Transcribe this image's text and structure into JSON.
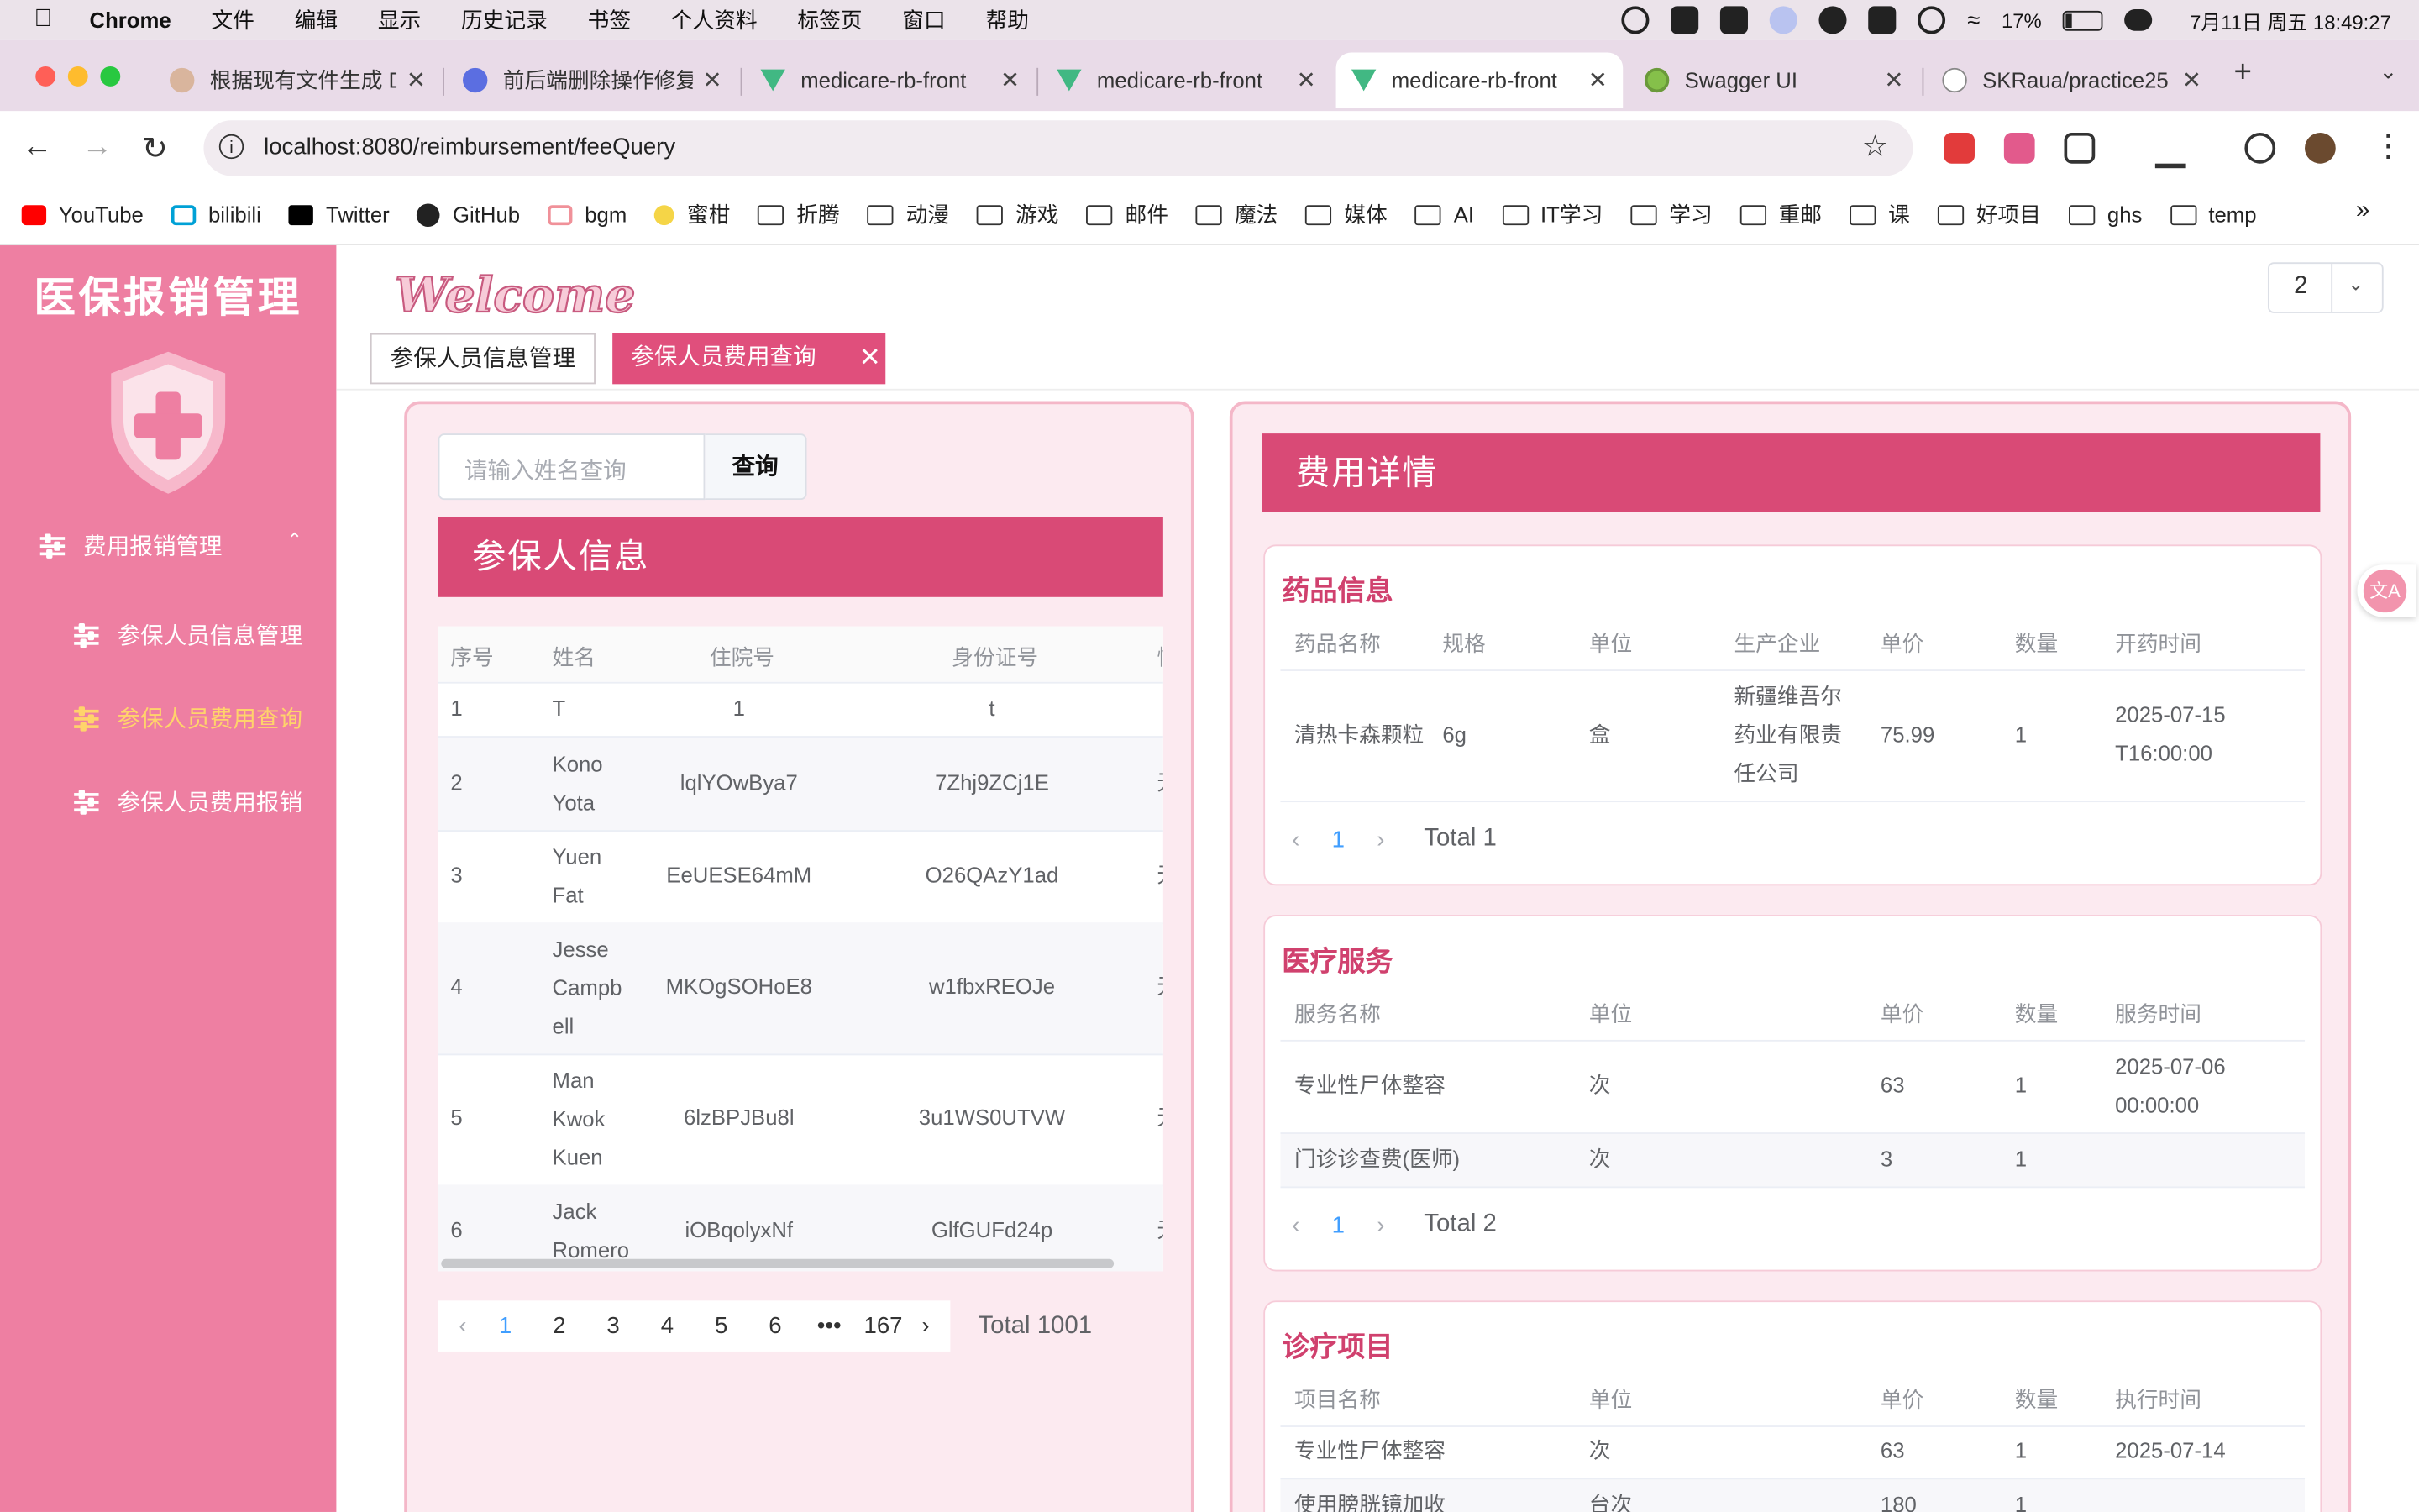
{
  "menubar": {
    "app_name": "Chrome",
    "items": [
      "文件",
      "编辑",
      "显示",
      "历史记录",
      "书签",
      "个人资料",
      "标签页",
      "窗口",
      "帮助"
    ],
    "battery": "17%",
    "datetime": "7月11日 周五  18:49:27",
    "status_icons": [
      "screen-record-icon",
      "cat-icon",
      "youdao-icon",
      "user-shield-icon",
      "bell-icon",
      "input-method-icon",
      "account-icon",
      "wifi-icon",
      "battery-icon",
      "control-center-icon"
    ]
  },
  "tabs": [
    {
      "title": "根据现有文件生成 D",
      "icon": "avatar-icon"
    },
    {
      "title": "前后端删除操作修复",
      "icon": "whale-icon"
    },
    {
      "title": "medicare-rb-front",
      "icon": "vue-icon"
    },
    {
      "title": "medicare-rb-front",
      "icon": "vue-icon"
    },
    {
      "title": "medicare-rb-front",
      "icon": "vue-icon",
      "active": true
    },
    {
      "title": "Swagger UI",
      "icon": "swagger-icon"
    },
    {
      "title": "SKRaua/practice25",
      "icon": "github-icon"
    }
  ],
  "address": {
    "url": "localhost:8080/reimbursement/feeQuery"
  },
  "bookmarks": [
    {
      "label": "YouTube",
      "icon": "youtube-icon"
    },
    {
      "label": "bilibili",
      "icon": "bilibili-icon"
    },
    {
      "label": "Twitter",
      "icon": "x-icon"
    },
    {
      "label": "GitHub",
      "icon": "github-icon"
    },
    {
      "label": "bgm",
      "icon": "bgm-icon"
    },
    {
      "label": "蜜柑",
      "icon": "mikan-icon"
    },
    {
      "label": "折腾",
      "icon": "folder-icon"
    },
    {
      "label": "动漫",
      "icon": "folder-icon"
    },
    {
      "label": "游戏",
      "icon": "folder-icon"
    },
    {
      "label": "邮件",
      "icon": "folder-icon"
    },
    {
      "label": "魔法",
      "icon": "folder-icon"
    },
    {
      "label": "媒体",
      "icon": "folder-icon"
    },
    {
      "label": "AI",
      "icon": "folder-icon"
    },
    {
      "label": "IT学习",
      "icon": "folder-icon"
    },
    {
      "label": "学习",
      "icon": "folder-icon"
    },
    {
      "label": "重邮",
      "icon": "folder-icon"
    },
    {
      "label": "课",
      "icon": "folder-icon"
    },
    {
      "label": "好项目",
      "icon": "folder-icon"
    },
    {
      "label": "ghs",
      "icon": "folder-icon"
    },
    {
      "label": "temp",
      "icon": "folder-icon"
    }
  ],
  "sidebar": {
    "brand": "医保报销管理",
    "group": "费用报销管理",
    "items": [
      {
        "label": "参保人员信息管理",
        "active": false
      },
      {
        "label": "参保人员费用查询",
        "active": true
      },
      {
        "label": "参保人员费用报销",
        "active": false
      }
    ]
  },
  "header": {
    "welcome": "Welcome",
    "page_select": "2",
    "tags": [
      "参保人员信息管理",
      "参保人员费用查询"
    ]
  },
  "left_panel": {
    "search_placeholder": "请输入姓名查询",
    "search_button": "查询",
    "title": "参保人信息",
    "columns": [
      "序号",
      "姓名",
      "住院号",
      "身份证号",
      "性"
    ],
    "rows": [
      {
        "no": "1",
        "name": "T",
        "hosp": "1",
        "id": "t",
        "extra": ""
      },
      {
        "no": "2",
        "name": "Kono Yota",
        "hosp": "lqlYOwBya7",
        "id": "7Zhj9ZCj1E",
        "extra": "无"
      },
      {
        "no": "3",
        "name": "Yuen Fat",
        "hosp": "EeUESE64mM",
        "id": "O26QAzY1ad",
        "extra": "无"
      },
      {
        "no": "4",
        "name": "Jesse Campbell",
        "hosp": "MKOgSOHoE8",
        "id": "w1fbxREOJe",
        "extra": "无"
      },
      {
        "no": "5",
        "name": "Man Kwok Kuen",
        "hosp": "6lzBPJBu8l",
        "id": "3u1WS0UTVW",
        "extra": "无"
      },
      {
        "no": "6",
        "name": "Jack Romero",
        "hosp": "iOBqolyxNf",
        "id": "GlfGUFd24p",
        "extra": "无"
      }
    ],
    "pagination": {
      "pages": [
        "1",
        "2",
        "3",
        "4",
        "5",
        "6",
        "•••",
        "167"
      ],
      "current": "1",
      "total": "Total 1001"
    }
  },
  "right_panel": {
    "title": "费用详情",
    "drugs": {
      "title": "药品信息",
      "columns": [
        "药品名称",
        "规格",
        "单位",
        "生产企业",
        "单价",
        "数量",
        "开药时间"
      ],
      "rows": [
        {
          "name": "清热卡森颗粒",
          "spec": "6g",
          "unit": "盒",
          "maker": "新疆维吾尔药业有限责任公司",
          "price": "75.99",
          "qty": "1",
          "time": "2025-07-15T16:00:00"
        }
      ],
      "pagination": {
        "current": "1",
        "total": "Total 1"
      }
    },
    "services": {
      "title": "医疗服务",
      "columns": [
        "服务名称",
        "单位",
        "单价",
        "数量",
        "服务时间"
      ],
      "rows": [
        {
          "name": "专业性尸体整容",
          "unit": "次",
          "price": "63",
          "qty": "1",
          "time": "2025-07-06 00:00:00"
        },
        {
          "name": "门诊诊查费(医师)",
          "unit": "次",
          "price": "3",
          "qty": "1",
          "time": ""
        }
      ],
      "pagination": {
        "current": "1",
        "total": "Total 2"
      }
    },
    "treatments": {
      "title": "诊疗项目",
      "columns": [
        "项目名称",
        "单位",
        "单价",
        "数量",
        "执行时间"
      ],
      "rows": [
        {
          "name": "专业性尸体整容",
          "unit": "次",
          "price": "63",
          "qty": "1",
          "time": "2025-07-14"
        },
        {
          "name": "使用膀胱镜加收",
          "unit": "台次",
          "price": "180",
          "qty": "1",
          "time": ""
        }
      ]
    }
  },
  "colors": {
    "sidebar": "#ee7fa2",
    "accent": "#d94a76",
    "active_menu": "#ffd36b",
    "panel_bg": "#fceaf0",
    "link": "#409eff"
  }
}
